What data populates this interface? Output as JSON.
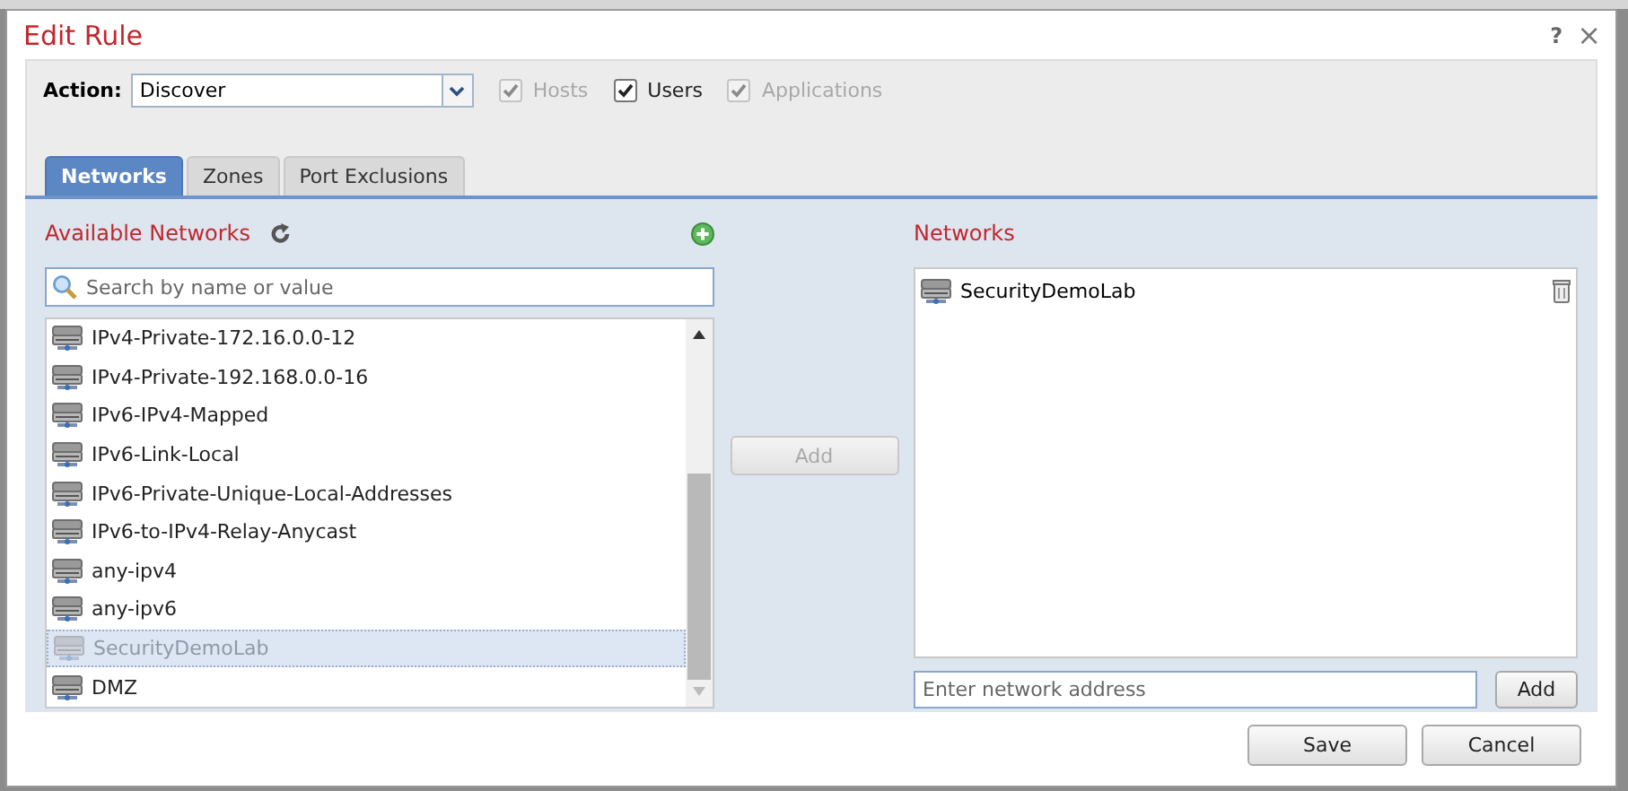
{
  "window": {
    "title": "Edit Rule",
    "help": "?",
    "close": "×"
  },
  "action": {
    "label": "Action:",
    "value": "Discover"
  },
  "options": [
    {
      "label": "Hosts",
      "checked": true,
      "disabled": true
    },
    {
      "label": "Users",
      "checked": true,
      "disabled": false
    },
    {
      "label": "Applications",
      "checked": true,
      "disabled": true
    }
  ],
  "tabs": [
    {
      "label": "Networks",
      "selected": true
    },
    {
      "label": "Zones",
      "selected": false
    },
    {
      "label": "Port Exclusions",
      "selected": false
    }
  ],
  "available_networks": {
    "title": "Available Networks",
    "search_placeholder": "Search by name or value",
    "items": [
      {
        "name": "IPv4-Private-172.16.0.0-12",
        "selected": false,
        "disabled": false
      },
      {
        "name": "IPv4-Private-192.168.0.0-16",
        "selected": false,
        "disabled": false
      },
      {
        "name": "IPv6-IPv4-Mapped",
        "selected": false,
        "disabled": false
      },
      {
        "name": "IPv6-Link-Local",
        "selected": false,
        "disabled": false
      },
      {
        "name": "IPv6-Private-Unique-Local-Addresses",
        "selected": false,
        "disabled": false
      },
      {
        "name": "IPv6-to-IPv4-Relay-Anycast",
        "selected": false,
        "disabled": false
      },
      {
        "name": "any-ipv4",
        "selected": false,
        "disabled": false
      },
      {
        "name": "any-ipv6",
        "selected": false,
        "disabled": false
      },
      {
        "name": "SecurityDemoLab",
        "selected": true,
        "disabled": true
      },
      {
        "name": "DMZ",
        "selected": false,
        "disabled": false
      }
    ]
  },
  "add_button": {
    "label": "Add",
    "disabled": true
  },
  "networks": {
    "title": "Networks",
    "items": [
      {
        "name": "SecurityDemoLab"
      }
    ],
    "address_placeholder": "Enter network address",
    "add_label": "Add"
  },
  "buttons": [
    "Save",
    "Cancel"
  ]
}
